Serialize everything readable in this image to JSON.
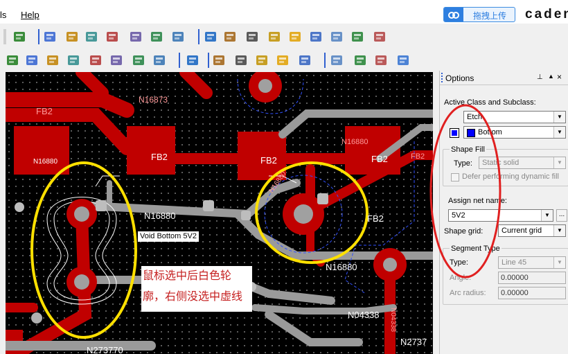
{
  "menubar": {
    "items": [
      "ls",
      "Help"
    ],
    "upload_label": "拖拽上传",
    "brand": "caden"
  },
  "colors": {
    "etch": "#c00000",
    "highlight_ellipse": "#ffe000",
    "callout": "#e02020",
    "bottom_layer": "#0000ff"
  },
  "toolbar1_icons": [
    "flip-icon",
    "grid-icon",
    "component-icon",
    "placement-icon",
    "route-icon",
    "em-icon",
    "dfa-icon",
    "globe-icon",
    "info-icon",
    "report-icon",
    "measure-icon",
    "brush-icon",
    "sun-icon",
    "spark-icon",
    "bar-chart-icon",
    "hourglass-icon",
    "disable-icon"
  ],
  "toolbar2_icons": [
    "pin-icon",
    "probe-icon",
    "camera-icon",
    "swap-icon",
    "bookmark-icon",
    "select-icon",
    "flow-icon",
    "matrix-icon",
    "curve-icon",
    "notes-icon",
    "book-icon",
    "library-icon",
    "check-icon",
    "pen-icon",
    "copy-icon",
    "envelope-icon",
    "mail-icon",
    "help-icon"
  ],
  "canvas": {
    "net_labels": {
      "n16873": "N16873",
      "fb2_left": "FB2",
      "fb2_mid": "FB2",
      "fb2_mid2": "FB2",
      "fb2_right": "FB2",
      "fb2_small": "FB2",
      "fb2_track": "FB2",
      "n16880_box": "N16880",
      "n16880_top": "N16880",
      "n16880_main": "N16880",
      "n16880_diag": "N16880",
      "n16880_low": "N16880",
      "n04338": "N04338",
      "n2737": "N2737",
      "n273770": "N273770",
      "via_text": "N04338"
    },
    "void_label": "Void   Bottom   5V2",
    "annotation_line1": "鼠标选中后白色轮",
    "annotation_line2": "廓，右侧没选中虚线"
  },
  "options": {
    "title": "Options",
    "pin_icon": "pushpin-icon",
    "active_class_label": "Active Class and Subclass:",
    "class_value": "Etch",
    "subclass_value": "Bottom",
    "shape_fill_label": "Shape Fill",
    "type_label": "Type:",
    "type_value": "Static solid",
    "defer_label": "Defer performing dynamic fill",
    "assign_net_label": "Assign net name:",
    "net_value": "5V2",
    "browse_label": "...",
    "shape_grid_label": "Shape grid:",
    "shape_grid_value": "Current grid",
    "segment_type_label": "Segment Type",
    "seg_type_label": "Type:",
    "seg_type_value": "Line 45",
    "angle_label": "Angle:",
    "angle_value": "0.00000",
    "arc_label": "Arc radius:",
    "arc_value": "0.00000"
  }
}
